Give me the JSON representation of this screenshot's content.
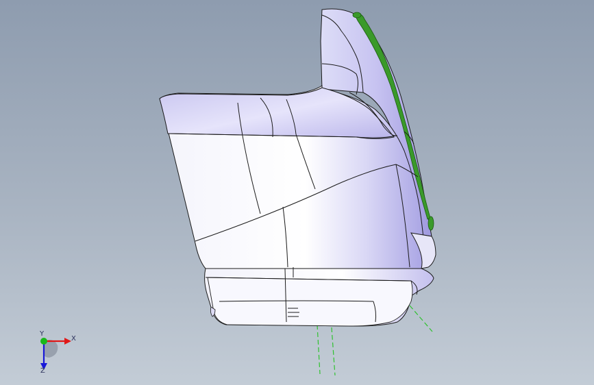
{
  "triad": {
    "x_label": "X",
    "y_label": "Y",
    "z_label": "Z"
  },
  "colors": {
    "background_top": "#8e9caf",
    "background_bottom": "#c3ccd6",
    "part_fill": "#eeeefb",
    "part_shade": "#b6b2ea",
    "edge": "#1a1a1a",
    "green_feature": "#3a9a2a",
    "sketch_line": "#2ec22e",
    "axis_x": "#e01818",
    "axis_y": "#18b818",
    "axis_z": "#1818d8"
  }
}
